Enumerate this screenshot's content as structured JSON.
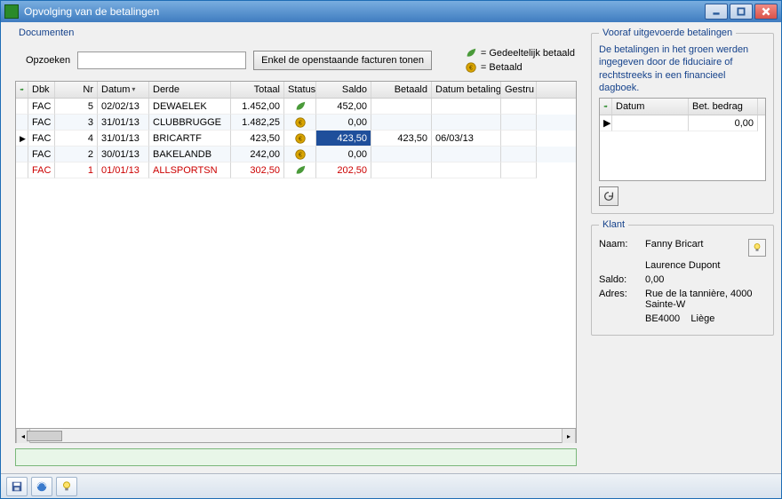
{
  "window": {
    "title": "Opvolging van de betalingen"
  },
  "docs": {
    "legend": "Documenten",
    "search_label": "Opzoeken",
    "search_value": "",
    "show_outstanding": "Enkel de openstaande facturen tonen",
    "legend_partial": "= Gedeeltelijk betaald",
    "legend_paid": "= Betaald",
    "columns": {
      "dbk": "Dbk",
      "nr": "Nr",
      "datum": "Datum",
      "derde": "Derde",
      "totaal": "Totaal",
      "status": "Status",
      "saldo": "Saldo",
      "betaald": "Betaald",
      "datum_betaling": "Datum betaling",
      "gestru": "Gestru"
    },
    "rows": [
      {
        "dbk": "FAC",
        "nr": "5",
        "datum": "02/02/13",
        "derde": "DEWAELEK",
        "totaal": "1.452,00",
        "status": "partial",
        "saldo": "452,00",
        "betaald": "",
        "datbet": "",
        "overdue": false
      },
      {
        "dbk": "FAC",
        "nr": "3",
        "datum": "31/01/13",
        "derde": "CLUBBRUGGE",
        "totaal": "1.482,25",
        "status": "paid",
        "saldo": "0,00",
        "betaald": "",
        "datbet": "",
        "overdue": false
      },
      {
        "dbk": "FAC",
        "nr": "4",
        "datum": "31/01/13",
        "derde": "BRICARTF",
        "totaal": "423,50",
        "status": "paid",
        "saldo": "423,50",
        "betaald": "423,50",
        "datbet": "06/03/13",
        "overdue": false,
        "selected": true
      },
      {
        "dbk": "FAC",
        "nr": "2",
        "datum": "30/01/13",
        "derde": "BAKELANDB",
        "totaal": "242,00",
        "status": "paid",
        "saldo": "0,00",
        "betaald": "",
        "datbet": "",
        "overdue": false
      },
      {
        "dbk": "FAC",
        "nr": "1",
        "datum": "01/01/13",
        "derde": "ALLSPORTSN",
        "totaal": "302,50",
        "status": "partial",
        "saldo": "202,50",
        "betaald": "",
        "datbet": "",
        "overdue": true
      }
    ]
  },
  "payments": {
    "legend": "Vooraf uitgevoerde betalingen",
    "info": "De betalingen in het groen werden ingegeven door de fiduciaire of rechtstreeks in een financieel dagboek.",
    "columns": {
      "datum": "Datum",
      "bedrag": "Bet. bedrag"
    },
    "rows": [
      {
        "datum": "",
        "bedrag": "0,00"
      }
    ]
  },
  "klant": {
    "legend": "Klant",
    "labels": {
      "naam": "Naam:",
      "saldo": "Saldo:",
      "adres": "Adres:"
    },
    "naam1": "Fanny Bricart",
    "naam2": "Laurence Dupont",
    "saldo": "0,00",
    "adres": "Rue de la tannière, 4000 Sainte-W",
    "postcode": "BE4000",
    "city": "Liège"
  }
}
